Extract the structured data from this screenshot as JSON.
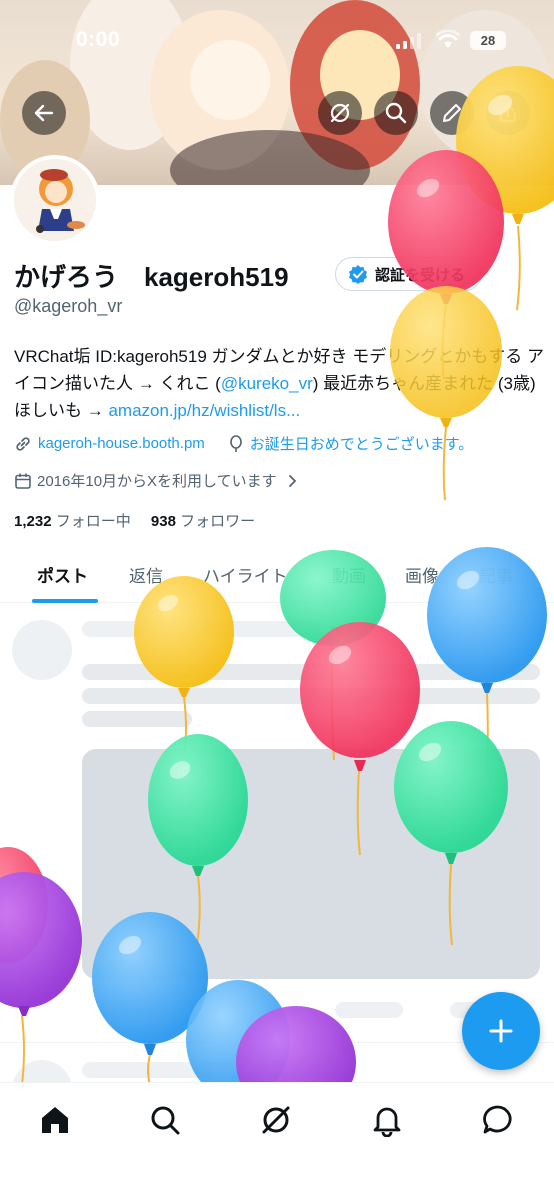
{
  "status_bar": {
    "time": "0:00",
    "battery": "28"
  },
  "header": {
    "back": "back-arrow-icon",
    "grok": "grok-icon",
    "search": "search-icon",
    "edit": "pencil-icon",
    "share": "share-icon"
  },
  "profile": {
    "name": "かげろう　kageroh519",
    "verify_button": "認証を受ける",
    "handle": "@kageroh_vr",
    "bio_1": "VRChat垢 ID:kageroh519 ガンダムとか好き モデリングとかもする アイコン描いた人 → くれこ (",
    "bio_mention": "@kureko_vr",
    "bio_2": ") 最近赤ちゃん産まれた (3歳) ほしいも → ",
    "bio_link": "amazon.jp/hz/wishlist/ls...",
    "website": "kageroh-house.booth.pm",
    "birthday": "お誕生日おめでとうございます。",
    "joined": "2016年10月からXを利用しています",
    "following_count": "1,232",
    "following_label": "フォロー中",
    "followers_count": "938",
    "followers_label": "フォロワー"
  },
  "tabs": [
    "ポスト",
    "返信",
    "ハイライト",
    "動画",
    "画像",
    "記事"
  ],
  "colors": {
    "accent": "#1d9bf0",
    "text": "#0f1419",
    "muted": "#536471"
  },
  "bottom_nav": [
    "home-icon",
    "search-icon",
    "grok-icon",
    "notifications-bell-icon",
    "messages-icon"
  ]
}
